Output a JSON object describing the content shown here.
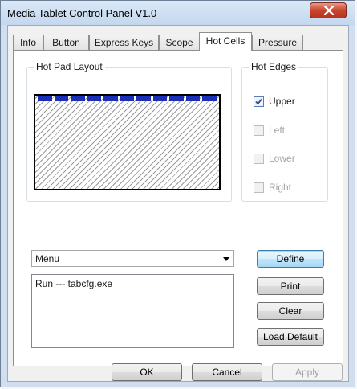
{
  "window": {
    "title": "Media Tablet Control Panel V1.0"
  },
  "tabs": [
    {
      "label": "Info"
    },
    {
      "label": "Button"
    },
    {
      "label": "Express Keys"
    },
    {
      "label": "Scope"
    },
    {
      "label": "Hot Cells"
    },
    {
      "label": "Pressure"
    }
  ],
  "active_tab": "Hot Cells",
  "hot_pad": {
    "legend": "Hot Pad Layout",
    "upper_cell_count": 11
  },
  "hot_edges": {
    "legend": "Hot Edges",
    "items": [
      {
        "label": "Upper",
        "checked": true,
        "enabled": true
      },
      {
        "label": "Left",
        "checked": false,
        "enabled": false
      },
      {
        "label": "Lower",
        "checked": false,
        "enabled": false
      },
      {
        "label": "Right",
        "checked": false,
        "enabled": false
      }
    ]
  },
  "action_combo": {
    "value": "Menu"
  },
  "assignments": {
    "items": [
      "Run --- tabcfg.exe"
    ]
  },
  "side_buttons": {
    "define": "Define",
    "print": "Print",
    "clear": "Clear",
    "load_default": "Load Default"
  },
  "footer": {
    "ok": "OK",
    "cancel": "Cancel",
    "apply": "Apply"
  },
  "colors": {
    "cell_blue": "#1a2fb8",
    "close_red": "#c8452e"
  }
}
